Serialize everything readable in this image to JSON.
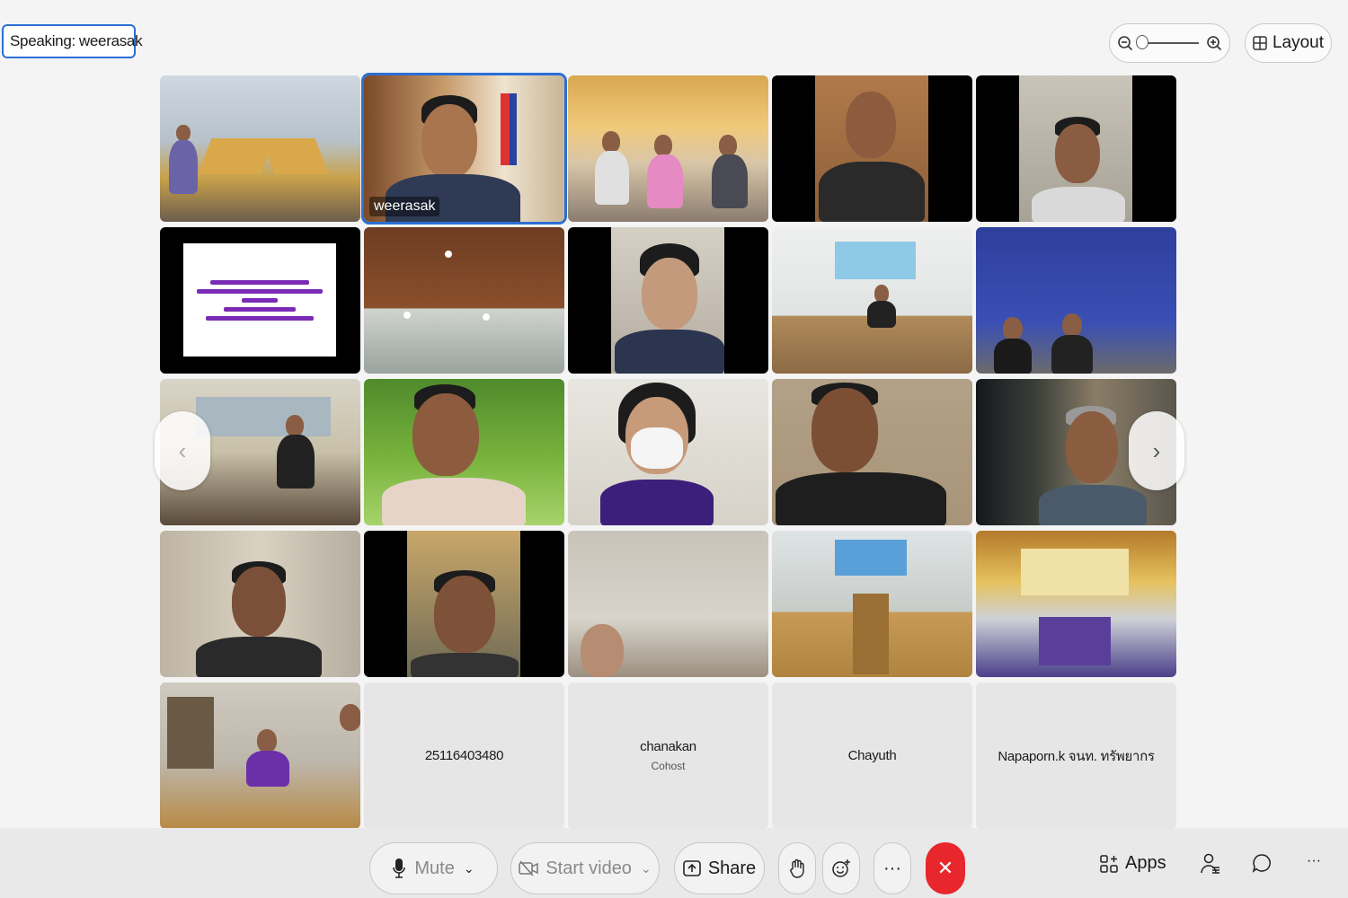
{
  "speaking": {
    "label": "Speaking:",
    "name": "weerasak"
  },
  "zoom": {
    "icon_minus": "zoom-out-icon",
    "icon_plus": "zoom-in-icon",
    "level": 0
  },
  "layout_label": "Layout",
  "active_speaker_tag": "weerasak",
  "participants_no_video": [
    {
      "name": "25116403480",
      "role": ""
    },
    {
      "name": "chanakan",
      "role": "Cohost"
    },
    {
      "name": "Chayuth",
      "role": ""
    },
    {
      "name": "Napaporn.k จนท. ทรัพยากร",
      "role": ""
    }
  ],
  "toolbar": {
    "mute": "Mute",
    "start_video": "Start video",
    "share": "Share",
    "more": "···",
    "apps": "Apps",
    "overflow": "···"
  },
  "colors": {
    "accent": "#2b6fd6",
    "end_call": "#e8272c",
    "background": "#f4f4f4"
  }
}
